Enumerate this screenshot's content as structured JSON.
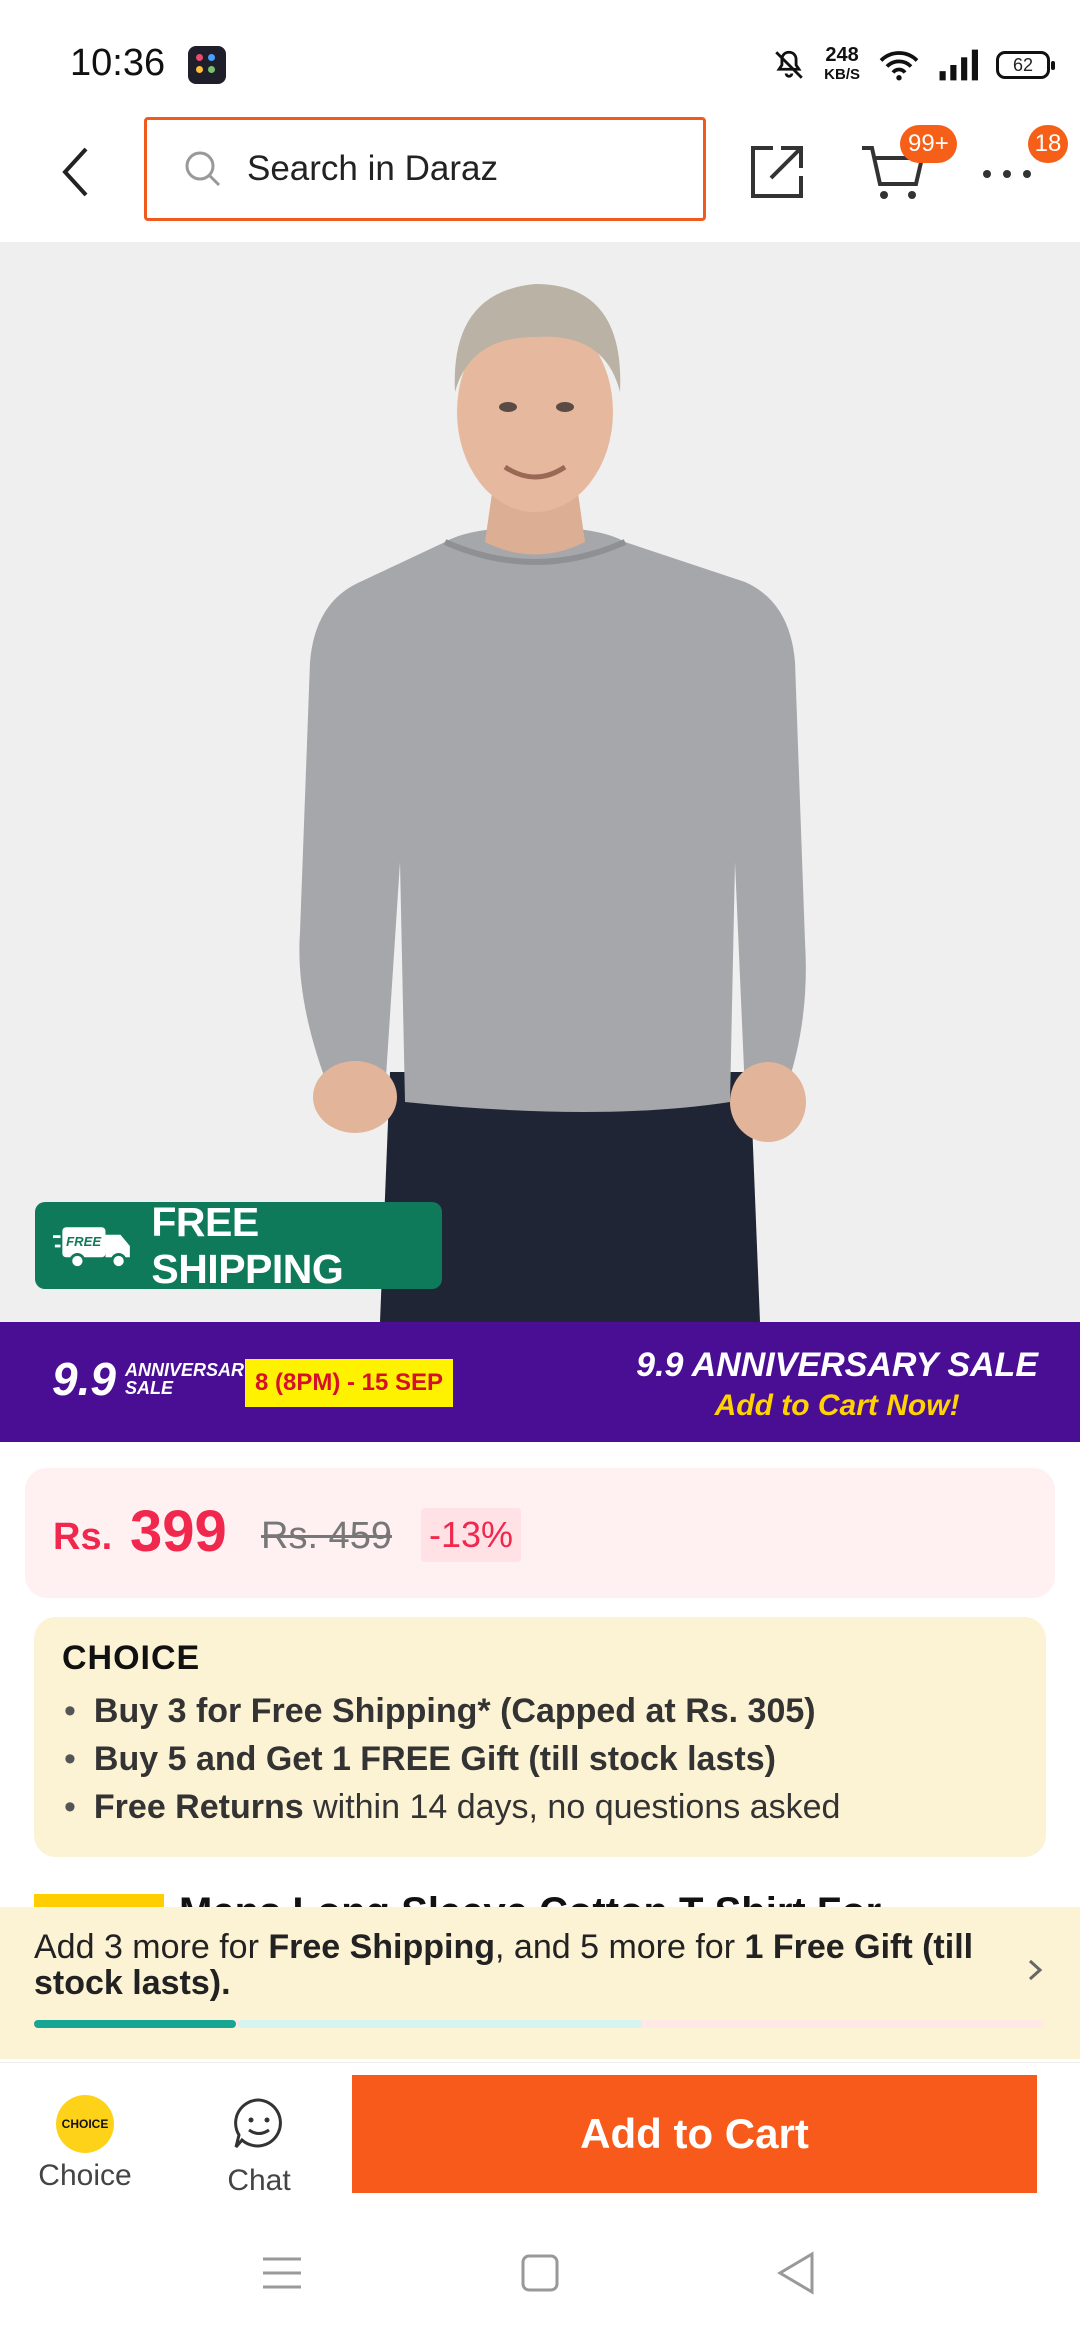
{
  "status_bar": {
    "time": "10:36",
    "net_speed_value": "248",
    "net_speed_unit": "KB/S",
    "battery_level": "62",
    "icons": [
      "app-icon",
      "mute-bell-icon",
      "wifi-icon",
      "signal-icon",
      "battery-icon"
    ]
  },
  "header": {
    "search_placeholder": "Search in Daraz",
    "cart_badge": "99+",
    "more_badge": "18",
    "icons": [
      "back-icon",
      "search-icon",
      "share-icon",
      "cart-icon",
      "more-icon"
    ]
  },
  "product_image": {
    "badge_text": "FREE SHIPPING",
    "badge_icon_text": "FREE",
    "badge_color": "#0f7a5a"
  },
  "sale_banner": {
    "logo_main": "9.9",
    "logo_line1": "ANNIVERSARY",
    "logo_line2": "SALE",
    "date_range": "8 (8PM) - 15 SEP",
    "title": "9.9 ANNIVERSARY SALE",
    "subtitle": "Add to Cart Now!",
    "bg_color": "#4a0e95"
  },
  "price": {
    "currency": "Rs.",
    "current": "399",
    "original": "Rs. 459",
    "discount": "-13%",
    "color": "#f0284e"
  },
  "choice": {
    "logo": "CHOICE",
    "items": [
      {
        "bold": "Buy 3 for  Free Shipping* (Capped at Rs. 305)",
        "rest": ""
      },
      {
        "bold": "Buy 5 and Get 1 FREE Gift (till stock lasts)",
        "rest": ""
      },
      {
        "bold": "Free Returns",
        "rest": " within 14 days, no questions asked"
      }
    ]
  },
  "product_title_peek": "Mens Long Sleeve Cotton T-Shirt For",
  "shipping_progress": {
    "text_1": "Add 3 more for ",
    "text_2": "Free Shipping",
    "text_3": ", and 5 more for ",
    "text_4": "1 Free Gift (till stock lasts).",
    "progress_fraction": 0.2,
    "accent": "#17a693"
  },
  "bottom_bar": {
    "choice_label": "Choice",
    "choice_coin_text": "CHOICE",
    "chat_label": "Chat",
    "add_to_cart_label": "Add to Cart",
    "button_color": "#f75a1a"
  },
  "nav_bar": {
    "icons": [
      "menu-icon",
      "home-icon",
      "back-triangle-icon"
    ]
  }
}
